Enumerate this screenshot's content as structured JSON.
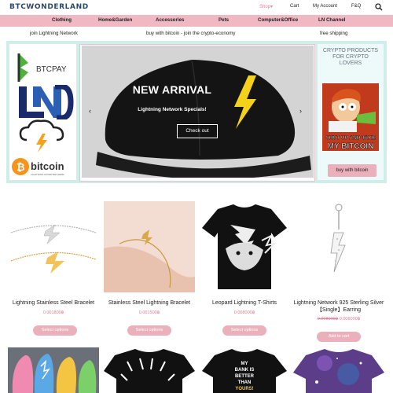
{
  "header": {
    "logo": "BTCWONDERLAND",
    "links": {
      "shop": "Shop",
      "cart": "Cart",
      "account": "My Account",
      "faq": "F&Q"
    }
  },
  "categories": [
    "Clothing",
    "Home&Garden",
    "Accessories",
    "Pets",
    "Computer&Office",
    "LN Channel"
  ],
  "promo": [
    "join Lightning Network",
    "buy with bitcoin - join the crypto-economy",
    "free shipping"
  ],
  "left_panel": {
    "logos": [
      "BTCPAY",
      "bitcoin",
      "LIGHTNING ACCEPTED HERE"
    ]
  },
  "slider": {
    "title": "NEW ARRIVAL",
    "subtitle": "Lightning Network Specials!",
    "button": "Check out",
    "prev": "‹",
    "next": "›"
  },
  "right_panel": {
    "title": "CRYPTO PRODUCTS FOR CRYPTO LOVERS",
    "meme_text": "SHUT UP AND TAKE MY BITCOIN",
    "button": "buy with bitcoin"
  },
  "products": [
    {
      "name": "Lightning Stainless Steel Bracelet",
      "price": "0.001800฿",
      "button": "Select options"
    },
    {
      "name": "Stainless Steel Lightning Bracelet",
      "price": "0.001500฿",
      "button": "Select options"
    },
    {
      "name": "Leopard Lightning T-Shirts",
      "price": "0.008000฿",
      "button": "Select options"
    },
    {
      "name": "Lightning Network 925 Sterling Silver【Single】Earring",
      "old_price": "0.008000฿",
      "price": "0.006000฿",
      "button": "Add to cart"
    }
  ],
  "shirt_text": [
    "MY",
    "BANK IS",
    "BETTER",
    "THAN",
    "YOURS!"
  ],
  "colors": {
    "accent": "#eab0bc",
    "nav": "#f0b8c3",
    "hero_bg": "#cfeeea",
    "price": "#e07a92"
  }
}
